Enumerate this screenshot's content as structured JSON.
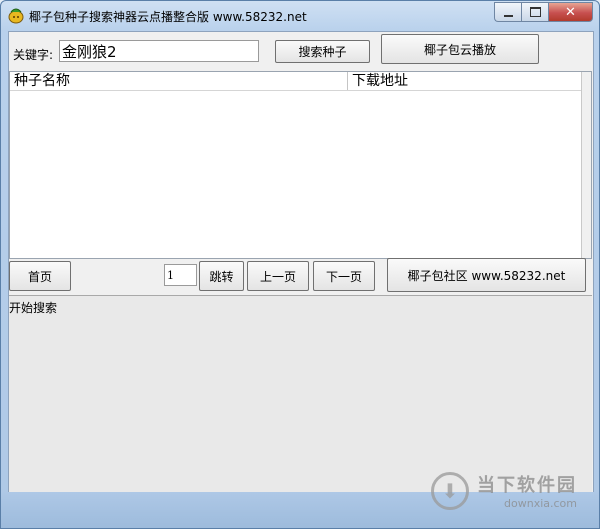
{
  "window": {
    "title": "椰子包种子搜索神器云点播整合版 www.58232.net"
  },
  "search": {
    "label": "关键字:",
    "value": "金刚狼2",
    "search_button": "搜索种子",
    "play_button": "椰子包云播放"
  },
  "list": {
    "columns": [
      "种子名称",
      "下载地址"
    ]
  },
  "pager": {
    "first_button": "首页",
    "page_value": "1",
    "jump_button": "跳转",
    "prev_button": "上一页",
    "next_button": "下一页",
    "community_button": "椰子包社区 www.58232.net"
  },
  "status": {
    "text": "开始搜索"
  },
  "watermark": {
    "cn": "当下软件园",
    "en": "downxia.com",
    "icon": "download-arrow-icon"
  }
}
